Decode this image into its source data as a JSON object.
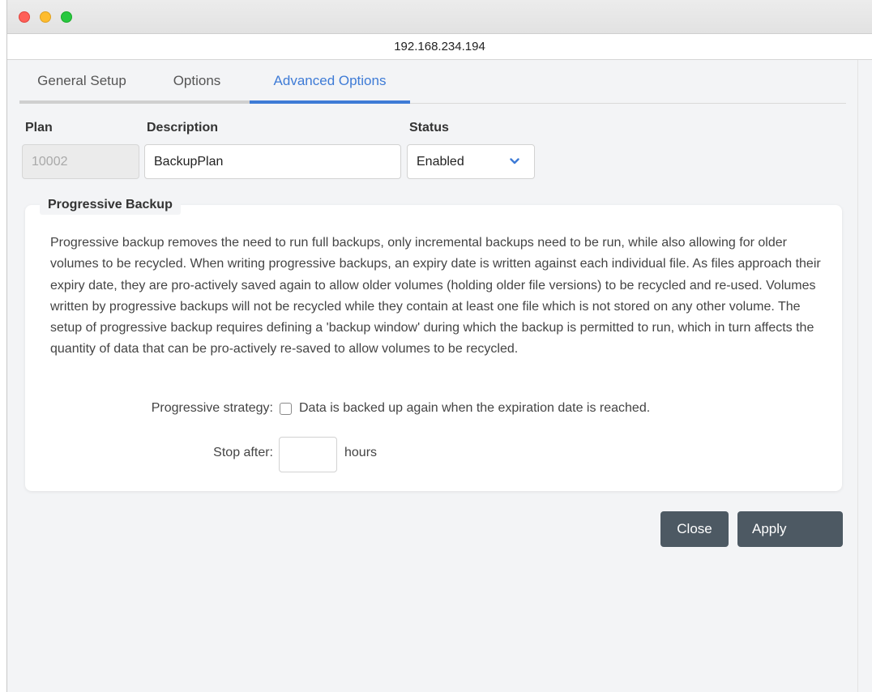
{
  "window": {
    "url": "192.168.234.194"
  },
  "tabs": [
    {
      "label": "General Setup",
      "active": false
    },
    {
      "label": "Options",
      "active": false
    },
    {
      "label": "Advanced Options",
      "active": true
    }
  ],
  "form": {
    "plan_label": "Plan",
    "plan_value": "10002",
    "description_label": "Description",
    "description_value": "BackupPlan",
    "status_label": "Status",
    "status_value": "Enabled"
  },
  "progressive": {
    "title": "Progressive Backup",
    "description": "Progressive backup removes the need to run full backups, only incremental backups need to be run, while also allowing for older volumes to be recycled. When writing progressive backups, an expiry date is written against each individual file. As files approach their expiry date, they are pro-actively saved again to allow older volumes (holding older file versions) to be recycled and re-used. Volumes written by progressive backups will not be recycled while they contain at least one file which is not stored on any other volume. The setup of progressive backup requires defining a 'backup window' during which the backup is permitted to run, which in turn affects the quantity of data that can be pro-actively re-saved to allow volumes to be recycled.",
    "strategy_label": "Progressive strategy:",
    "strategy_checkbox_label": "Data is backed up again when the expiration date is reached.",
    "strategy_checked": false,
    "stop_after_label": "Stop after:",
    "stop_after_value": "",
    "hours_label": "hours"
  },
  "buttons": {
    "close": "Close",
    "apply": "Apply"
  },
  "colors": {
    "accent": "#3e7bd6",
    "button": "#4d5963",
    "background": "#f3f4f6"
  }
}
